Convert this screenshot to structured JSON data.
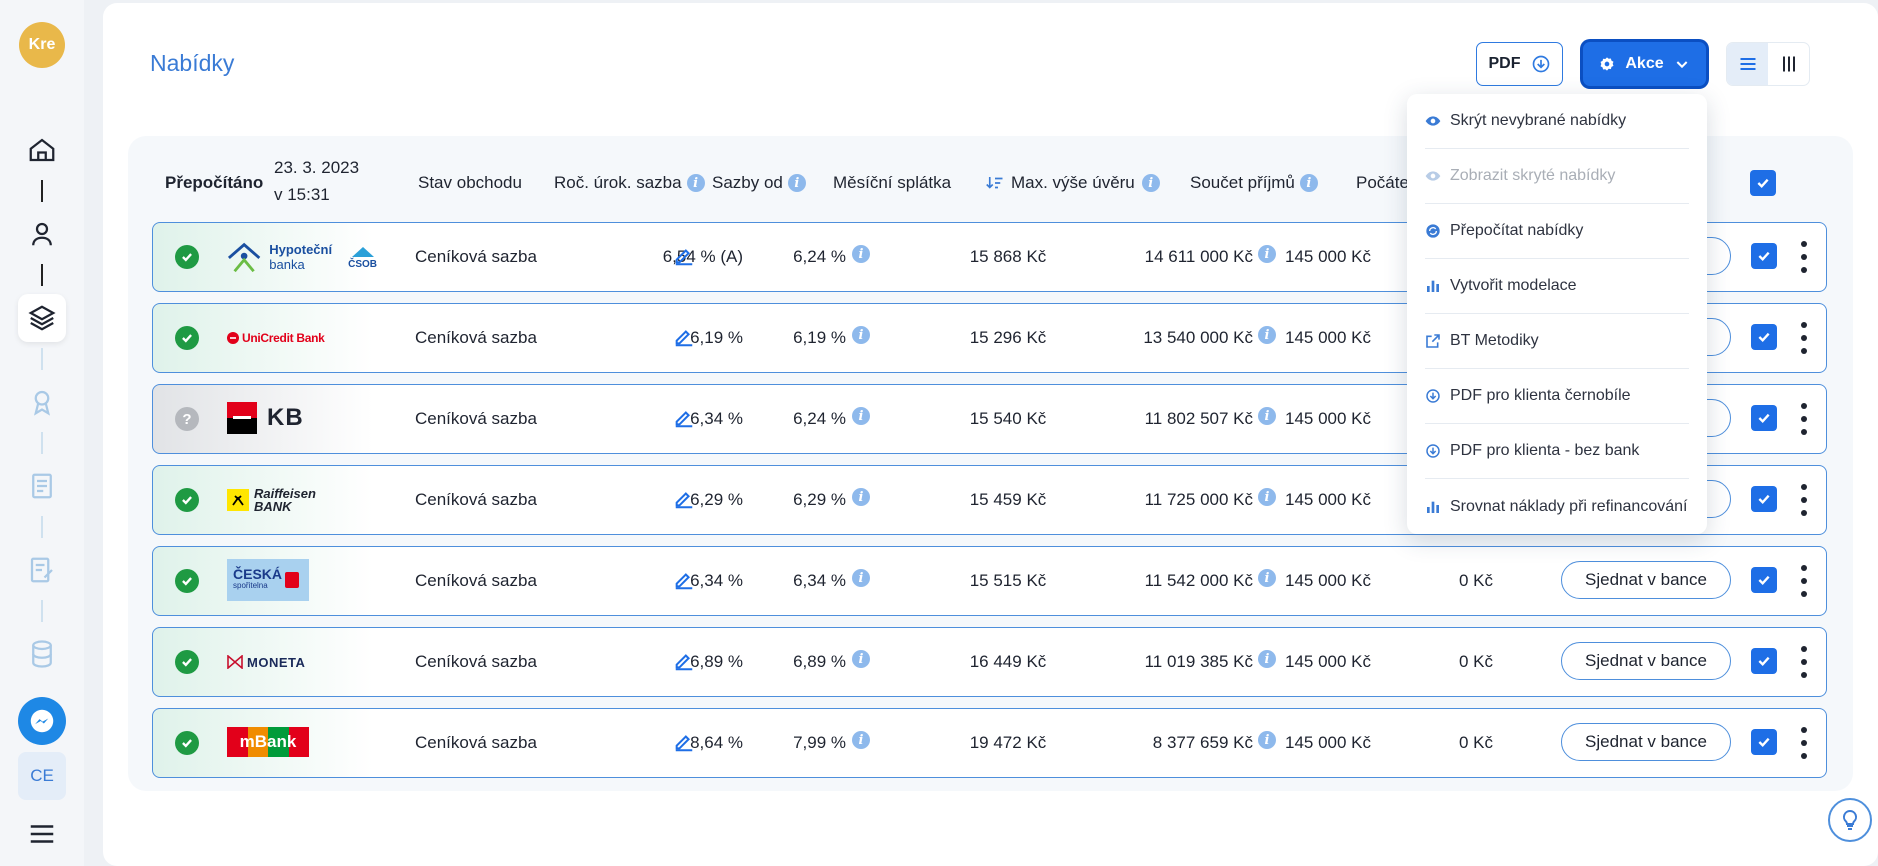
{
  "sidebar": {
    "avatar": "Kre",
    "ce_label": "CE"
  },
  "header": {
    "title": "Nabídky",
    "pdf_label": "PDF",
    "akce_label": "Akce"
  },
  "table": {
    "recalc_label": "Přepočítáno",
    "recalc_date": "23. 3. 2023",
    "recalc_time": "v 15:31",
    "columns": {
      "stav": "Stav obchodu",
      "rocni": "Roč. úrok. sazba",
      "sazby_od": "Sazby od",
      "mesicni": "Měsíční splátka",
      "max": "Max. výše úvěru",
      "soucet": "Součet příjmů",
      "pocet": "Počáte"
    },
    "rows": [
      {
        "bank": "Hypoteční banka ČSOB",
        "status": "ok",
        "stav": "Ceníková sazba",
        "rate": "6,54 % (A)",
        "from": "6,24 %",
        "monthly": "15 868 Kč",
        "max": "14 611 000 Kč",
        "income": "145 000 Kč",
        "fee": "",
        "action": ""
      },
      {
        "bank": "UniCredit Bank",
        "status": "ok",
        "stav": "Ceníková sazba",
        "rate": "6,19 %",
        "from": "6,19 %",
        "monthly": "15 296 Kč",
        "max": "13 540 000 Kč",
        "income": "145 000 Kč",
        "fee": "",
        "action": ""
      },
      {
        "bank": "KB",
        "status": "unknown",
        "stav": "Ceníková sazba",
        "rate": "6,34 %",
        "from": "6,24 %",
        "monthly": "15 540 Kč",
        "max": "11 802 507 Kč",
        "income": "145 000 Kč",
        "fee": "",
        "action": ""
      },
      {
        "bank": "Raiffeisen BANK",
        "status": "ok",
        "stav": "Ceníková sazba",
        "rate": "6,29 %",
        "from": "6,29 %",
        "monthly": "15 459 Kč",
        "max": "11 725 000 Kč",
        "income": "145 000 Kč",
        "fee": "",
        "action": ""
      },
      {
        "bank": "Česká spořitelna",
        "status": "ok",
        "stav": "Ceníková sazba",
        "rate": "6,34 %",
        "from": "6,34 %",
        "monthly": "15 515 Kč",
        "max": "11 542 000 Kč",
        "income": "145 000 Kč",
        "fee": "0 Kč",
        "action": "Sjednat v bance"
      },
      {
        "bank": "MONETA",
        "status": "ok",
        "stav": "Ceníková sazba",
        "rate": "6,89 %",
        "from": "6,89 %",
        "monthly": "16 449 Kč",
        "max": "11 019 385 Kč",
        "income": "145 000 Kč",
        "fee": "0 Kč",
        "action": "Sjednat v bance"
      },
      {
        "bank": "mBank",
        "status": "ok",
        "stav": "Ceníková sazba",
        "rate": "8,64 %",
        "from": "7,99 %",
        "monthly": "19 472 Kč",
        "max": "8 377 659 Kč",
        "income": "145 000 Kč",
        "fee": "0 Kč",
        "action": "Sjednat v bance"
      }
    ]
  },
  "logos": {
    "hb1": "Hypoteční",
    "hb2": "banka",
    "csob": "ČSOB",
    "unicredit": "UniCredit Bank",
    "kb": "KB",
    "rb1": "Raiffeisen",
    "rb2": "BANK",
    "cs1": "ČESKÁ",
    "cs2": "spořitelna",
    "moneta": "MONETA",
    "mbank": "mBank"
  },
  "menu": [
    {
      "label": "Skrýt nevybrané nabídky",
      "icon": "eye-icon",
      "disabled": false
    },
    {
      "label": "Zobrazit skryté nabídky",
      "icon": "eye-icon",
      "disabled": true
    },
    {
      "label": "Přepočítat nabídky",
      "icon": "recalc-icon",
      "disabled": false
    },
    {
      "label": "Vytvořit modelace",
      "icon": "bar-chart-icon",
      "disabled": false
    },
    {
      "label": "BT Metodiky",
      "icon": "external-link-icon",
      "disabled": false
    },
    {
      "label": "PDF pro klienta černobíle",
      "icon": "download-icon",
      "disabled": false
    },
    {
      "label": "PDF pro klienta - bez bank",
      "icon": "download-icon",
      "disabled": false
    },
    {
      "label": "Srovnat náklady při refinancování",
      "icon": "bar-chart-icon",
      "disabled": false
    }
  ],
  "colors": {
    "accent": "#1e6ee6",
    "ok": "#1f9a43",
    "title": "#3a7bd5"
  }
}
